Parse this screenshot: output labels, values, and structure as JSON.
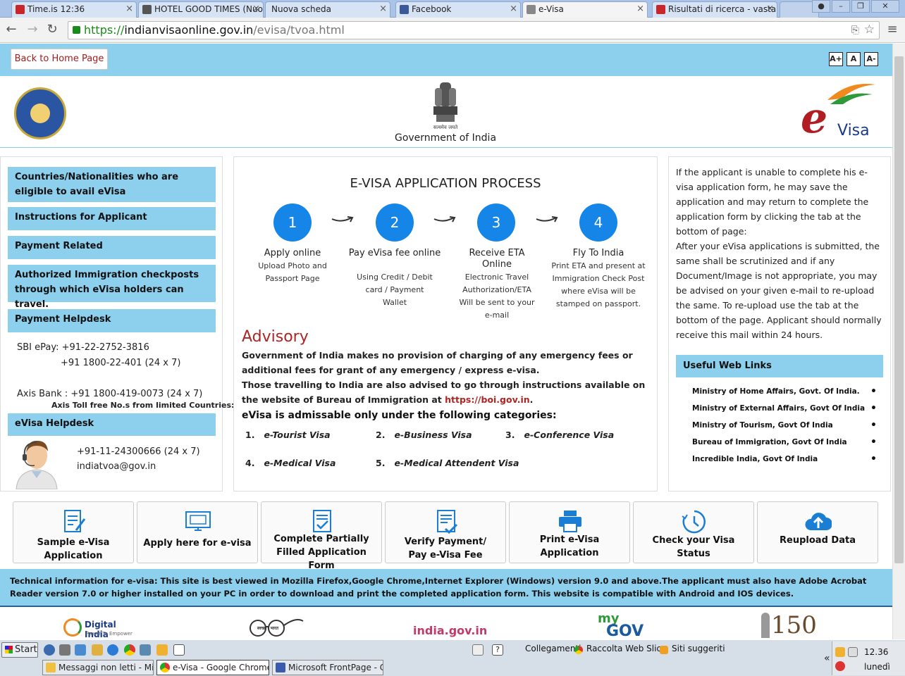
{
  "browser": {
    "tabs": [
      {
        "label": "Time.is 12:36",
        "color": "#c9262b"
      },
      {
        "label": "HOTEL GOOD TIMES (Nuo",
        "color": "#555555"
      },
      {
        "label": "Nuova scheda",
        "color": ""
      },
      {
        "label": "Facebook",
        "color": "#3b5998"
      },
      {
        "label": "e-Visa",
        "color": "#888888"
      },
      {
        "label": "Risultati di ricerca - vastan",
        "color": "#c9262b"
      }
    ],
    "url_scheme": "https://",
    "url_domain": "indianvisaonline.gov.in",
    "url_path": "/evisa/tvoa.html"
  },
  "topbar": {
    "home_button": "Back to Home Page",
    "font_buttons": [
      "A+",
      "A",
      "A-"
    ]
  },
  "header": {
    "emblem_caption": "सत्यमेव जयते",
    "gov_text": "Government of India",
    "evisa_logo_text": "Visa"
  },
  "left": {
    "menu": [
      "Countries/Nationalities who are eligible to avail eVisa",
      "Instructions for Applicant",
      "Payment Related",
      "Authorized Immigration checkposts through which eVisa holders can travel.",
      "Payment Helpdesk"
    ],
    "sbi_line1": "SBI ePay: +91-22-2752-3816",
    "sbi_line2": "+91 1800-22-401 (24 x 7)",
    "axis_line": "Axis Bank : +91 1800-419-0073 (24 x 7)",
    "axis_toll": "Axis Toll free No.s from limited Countries:",
    "helpdesk_title": "eVisa Helpdesk",
    "helpdesk_phone": "+91-11-24300666 (24 x 7)",
    "helpdesk_email": "indiatvoa@gov.in"
  },
  "process": {
    "title": "E-VISA APPLICATION PROCESS",
    "steps": [
      {
        "num": "1",
        "title": "Apply online",
        "desc": "Upload Photo and Passport Page"
      },
      {
        "num": "2",
        "title": "Pay eVisa fee online",
        "desc": "Using Credit / Debit card / Payment Wallet"
      },
      {
        "num": "3",
        "title": "Receive ETA Online",
        "desc": "Electronic Travel Authorization/ETA Will be sent to your e-mail"
      },
      {
        "num": "4",
        "title": "Fly To India",
        "desc": "Print ETA and present at Immigration Check Post where eVisa will be stamped on passport."
      }
    ]
  },
  "advisory": {
    "title": "Advisory",
    "line1": "Government of India makes no provision of charging of any emergency fees or additional fees for grant of any emergency / express e-visa.",
    "line2_prefix": "Those travelling to India are also advised to go through instructions available on the website of Bureau of Immigration at ",
    "link": "https://boi.gov.in",
    "line2_suffix": "."
  },
  "categories": {
    "title": "eVisa is admissable only under the following categories:",
    "items": [
      {
        "num": "1.",
        "label": "e-Tourist Visa"
      },
      {
        "num": "2.",
        "label": "e-Business Visa"
      },
      {
        "num": "3.",
        "label": "e-Conference Visa"
      },
      {
        "num": "4.",
        "label": "e-Medical Visa"
      },
      {
        "num": "5.",
        "label": "e-Medical Attendent Visa"
      }
    ]
  },
  "right": {
    "para1": "If the applicant is unable to complete his e-visa application form, he may save the application and may return to complete the application form by clicking the tab at the bottom of page:",
    "para2": "After your eVisa applications is submitted, the same shall be scrutinized and if any Document/Image is not appropriate, you may be advised on your given e-mail to re-upload the same. To re-upload use the tab at the bottom of the page. Applicant should normally receive this mail within 24 hours.",
    "useful_title": "Useful Web Links",
    "links": [
      "Ministry of Home Affairs, Govt. Of India.",
      "Ministry of External Affairs, Govt Of India",
      "Ministry of Tourism, Govt Of India",
      "Bureau of Immigration, Govt Of India",
      "Incredible India, Govt Of India"
    ]
  },
  "actions": [
    {
      "line1": "Sample e-Visa",
      "line2": "Application"
    },
    {
      "line1": "Apply here for e-visa",
      "line2": ""
    },
    {
      "line1": "Complete Partially",
      "line2": "Filled Application Form"
    },
    {
      "line1": "Verify Payment/",
      "line2": "Pay e-Visa Fee"
    },
    {
      "line1": "Print e-Visa Application",
      "line2": ""
    },
    {
      "line1": "Check your Visa Status",
      "line2": ""
    },
    {
      "line1": "Reupload Data",
      "line2": ""
    }
  ],
  "tech_info": "Technical information for e-visa: This site is best viewed in Mozilla Firefox,Google Chrome,Internet Explorer (Windows) version 9.0 and above.The applicant must also have Adobe Acrobat Reader version 7.0 or higher installed on your PC in order to download and print the completed application form. This website is compatible with Android and IOS devices.",
  "footer_logos": {
    "digital_india": "Digital India",
    "digital_india_sub": "Power To Empower",
    "india_gov": "india.gov.in",
    "mygov_my": "my",
    "mygov_gov": "GOV",
    "swachh": "स्वच्छ · भारत",
    "gandhi150": "150"
  },
  "taskbar": {
    "start": "Start",
    "links_label": "Collegamenti",
    "raccolta": "Raccolta Web Slice",
    "siti": "Siti suggeriti",
    "tasks": [
      "Messaggi non letti - Micr...",
      "e-Visa - Google Chrome",
      "Microsoft FrontPage - C:..."
    ],
    "time": "12.36",
    "day": "lunedì"
  },
  "colors": {
    "accent_blue": "#1685e8",
    "band_blue": "#8dd0ee",
    "advisory_red": "#b02424"
  }
}
